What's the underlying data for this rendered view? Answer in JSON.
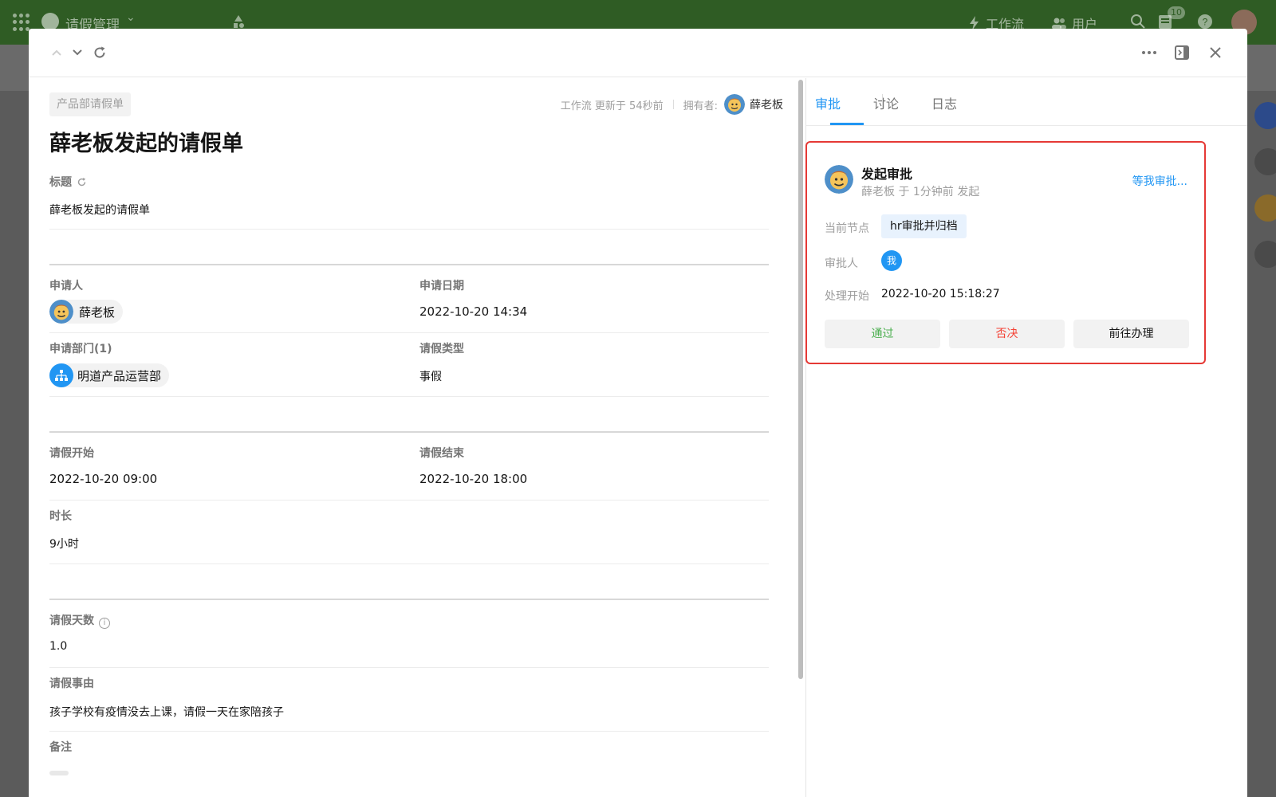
{
  "app": {
    "title": "请假管理",
    "nav_workflow": "工作流",
    "nav_users": "用户",
    "notification_count": "10"
  },
  "form": {
    "tag": "产品部请假单",
    "meta_prefix": "工作流 更新于 54秒前",
    "owner_label": "拥有者:",
    "owner_name": "薛老板",
    "record_title": "薛老板发起的请假单"
  },
  "fields": {
    "title_label": "标题",
    "title_value": "薛老板发起的请假单",
    "applicant_label": "申请人",
    "applicant_value": "薛老板",
    "apply_date_label": "申请日期",
    "apply_date_value": "2022-10-20 14:34",
    "dept_label": "申请部门(1)",
    "dept_value": "明道产品运营部",
    "leave_type_label": "请假类型",
    "leave_type_value": "事假",
    "leave_start_label": "请假开始",
    "leave_start_value": "2022-10-20 09:00",
    "leave_end_label": "请假结束",
    "leave_end_value": "2022-10-20 18:00",
    "duration_label": "时长",
    "duration_value": "9小时",
    "days_label": "请假天数",
    "days_value": "1.0",
    "reason_label": "请假事由",
    "reason_value": "孩子学校有疫情没去上课，请假一天在家陪孩子",
    "remark_label": "备注"
  },
  "panel": {
    "tabs": [
      "审批",
      "讨论",
      "日志"
    ],
    "active_tab": "审批",
    "card": {
      "title": "发起审批",
      "subtitle": "薛老板 于 1分钟前 发起",
      "link": "等我审批...",
      "node_label": "当前节点",
      "node_value": "hr审批并归档",
      "approver_label": "审批人",
      "approver_value": "我",
      "start_label": "处理开始",
      "start_value": "2022-10-20 15:18:27",
      "btn_pass": "通过",
      "btn_reject": "否决",
      "btn_goto": "前往办理"
    }
  },
  "colors": {
    "topbar": "#2f5c24",
    "accent": "#2196f3",
    "pass": "#4caf50",
    "reject": "#f44336",
    "highlight_border": "#e53935"
  },
  "icons": [
    "grid-icon",
    "app-logo-icon",
    "bolt-icon",
    "users-icon",
    "search-icon",
    "notes-icon",
    "help-icon",
    "chevron-up-icon",
    "chevron-down-icon",
    "refresh-icon",
    "more-icon",
    "sidebar-toggle-icon",
    "close-icon",
    "info-icon",
    "dept-tree-icon"
  ]
}
